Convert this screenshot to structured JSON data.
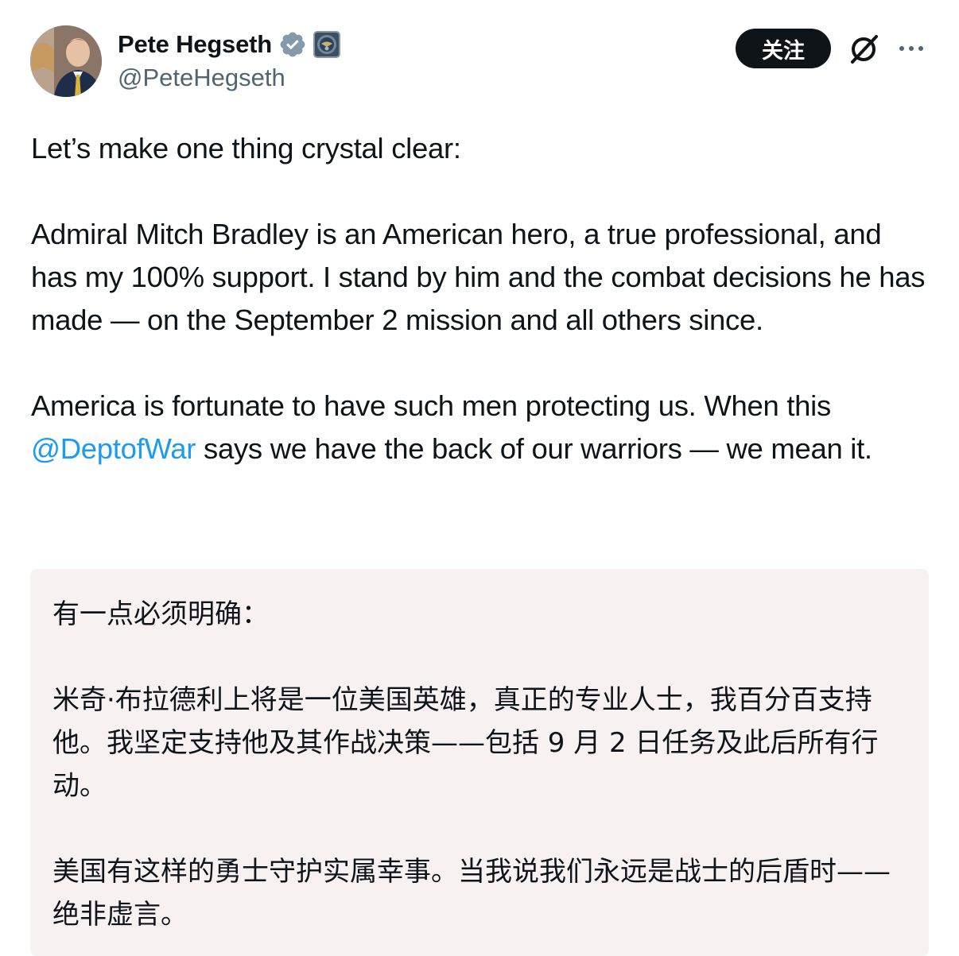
{
  "author": {
    "display_name": "Pete Hegseth",
    "handle": "@PeteHegseth",
    "verified_icon": "verified-badge-icon",
    "affiliation_icon": "department-seal-icon"
  },
  "actions": {
    "follow_label": "关注",
    "grok_icon": "grok-icon",
    "more_icon": "more-horizontal-icon"
  },
  "tweet": {
    "line1": "Let’s make one thing crystal clear:",
    "para2": "Admiral Mitch Bradley is an American hero, a true professional, and has my 100% support. I stand by him and the combat decisions he has made — on the September 2 mission and all others since.",
    "para3_before": "America is fortunate to have such men protecting us. When this ",
    "mention": "@DeptofWar",
    "para3_after": " says we have the back of our warriors — we mean it."
  },
  "translation": {
    "line1": "有一点必须明确：",
    "para2": "米奇·布拉德利上将是一位美国英雄，真正的专业人士，我百分百支持他。我坚定支持他及其作战决策——包括 9 月 2 日任务及此后所有行动。",
    "para3": "美国有这样的勇士守护实属幸事。当我说我们永远是战士的后盾时——绝非虚言。"
  },
  "colors": {
    "text": "#0f1419",
    "secondary": "#536471",
    "link": "#1d9bf0",
    "verified": "#829aab",
    "translation_bg": "#f8f1f1"
  }
}
